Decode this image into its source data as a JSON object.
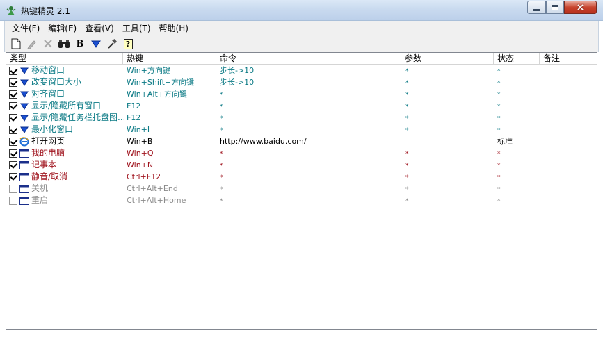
{
  "window": {
    "title": "热键精灵 2.1",
    "close_glyph": "×"
  },
  "menu": [
    {
      "label": "文件(F)"
    },
    {
      "label": "编辑(E)"
    },
    {
      "label": "查看(V)"
    },
    {
      "label": "工具(T)"
    },
    {
      "label": "帮助(H)"
    }
  ],
  "toolbar": {
    "bold_label": "B",
    "help_label": "?"
  },
  "columns": {
    "type": "类型",
    "hotkey": "热键",
    "command": "命令",
    "param": "参数",
    "state": "状态",
    "note": "备注"
  },
  "rows": [
    {
      "name": "移动窗口",
      "hotkey": "Win+方向键",
      "command": "步长->10",
      "param": "*",
      "state": "*",
      "checked": true,
      "group": "teal",
      "icon": "arrow-down-icon"
    },
    {
      "name": "改变窗口大小",
      "hotkey": "Win+Shift+方向键",
      "command": "步长->10",
      "param": "*",
      "state": "*",
      "checked": true,
      "group": "teal",
      "icon": "arrow-down-icon"
    },
    {
      "name": "对齐窗口",
      "hotkey": "Win+Alt+方向键",
      "command": "*",
      "param": "*",
      "state": "*",
      "checked": true,
      "group": "teal",
      "icon": "arrow-down-icon"
    },
    {
      "name": "显示/隐藏所有窗口",
      "hotkey": "F12",
      "command": "*",
      "param": "*",
      "state": "*",
      "checked": true,
      "group": "teal",
      "icon": "arrow-down-icon"
    },
    {
      "name": "显示/隐藏任务栏托盘图...",
      "hotkey": "F12",
      "command": "*",
      "param": "*",
      "state": "*",
      "checked": true,
      "group": "teal",
      "icon": "arrow-down-icon"
    },
    {
      "name": "最小化窗口",
      "hotkey": "Win+I",
      "command": "*",
      "param": "*",
      "state": "*",
      "checked": true,
      "group": "teal",
      "icon": "arrow-down-icon"
    },
    {
      "name": "打开网页",
      "hotkey": "Win+B",
      "command": "http://www.baidu.com/",
      "param": "",
      "state": "标准",
      "checked": true,
      "group": "black",
      "icon": "ie-icon"
    },
    {
      "name": "我的电脑",
      "hotkey": "Win+Q",
      "command": "*",
      "param": "*",
      "state": "*",
      "checked": true,
      "group": "red",
      "icon": "window-icon"
    },
    {
      "name": "记事本",
      "hotkey": "Win+N",
      "command": "*",
      "param": "*",
      "state": "*",
      "checked": true,
      "group": "red",
      "icon": "window-icon"
    },
    {
      "name": "静音/取消",
      "hotkey": "Ctrl+F12",
      "command": "*",
      "param": "*",
      "state": "*",
      "checked": true,
      "group": "red",
      "icon": "window-icon"
    },
    {
      "name": "关机",
      "hotkey": "Ctrl+Alt+End",
      "command": "*",
      "param": "*",
      "state": "*",
      "checked": false,
      "group": "gray",
      "icon": "window-icon"
    },
    {
      "name": "重启",
      "hotkey": "Ctrl+Alt+Home",
      "command": "*",
      "param": "*",
      "state": "*",
      "checked": false,
      "group": "gray",
      "icon": "window-icon"
    }
  ],
  "colors": {
    "teal": "#0b7a85",
    "red": "#a0141e",
    "gray": "#8a8a8a",
    "arrow_blue": "#1a4fd1"
  }
}
